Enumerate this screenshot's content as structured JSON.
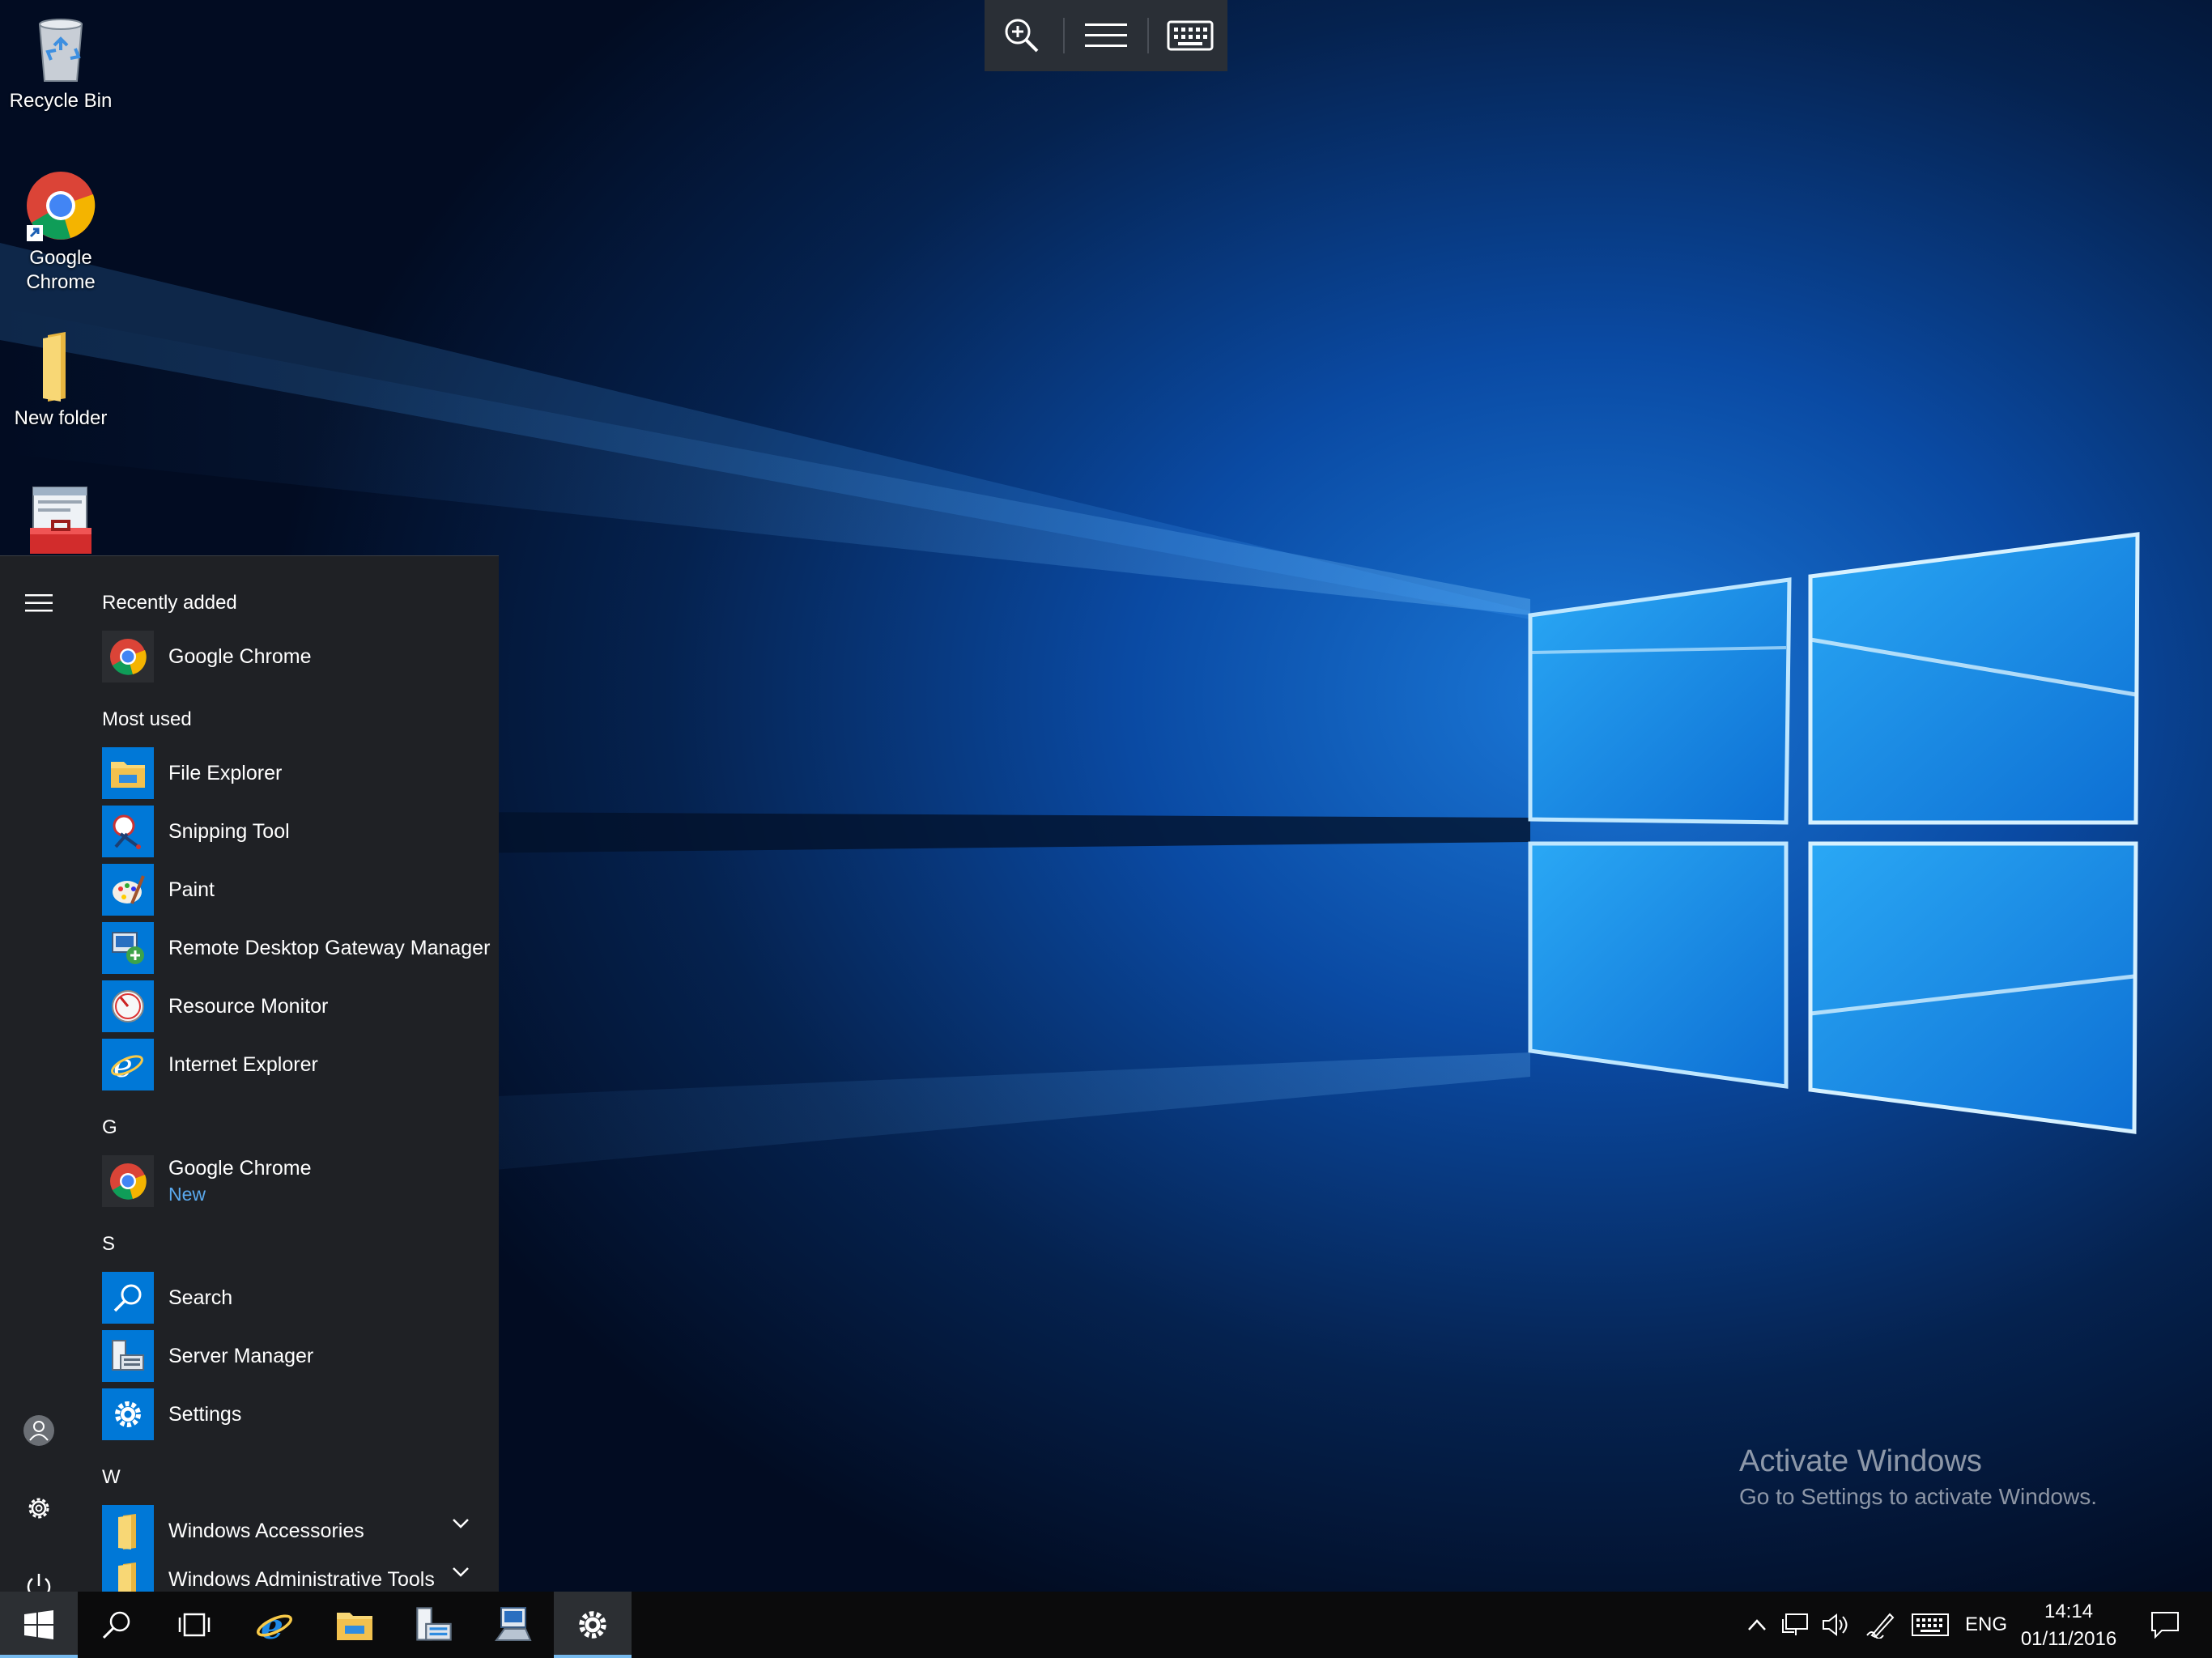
{
  "desktop": {
    "icons": [
      {
        "label": "Recycle Bin"
      },
      {
        "label": "Google Chrome"
      },
      {
        "label": "New folder"
      },
      {
        "label": ""
      }
    ]
  },
  "rdp_toolbar": {
    "buttons": [
      "zoom-in-icon",
      "menu-icon",
      "keyboard-icon"
    ]
  },
  "start_menu": {
    "sections": {
      "recently_added": "Recently added",
      "most_used": "Most used",
      "g": "G",
      "s": "S",
      "w": "W"
    },
    "recently_added": [
      {
        "name": "Google Chrome",
        "icon": "chrome-icon"
      }
    ],
    "most_used": [
      {
        "name": "File Explorer",
        "icon": "file-explorer-icon"
      },
      {
        "name": "Snipping Tool",
        "icon": "snipping-tool-icon"
      },
      {
        "name": "Paint",
        "icon": "paint-icon"
      },
      {
        "name": "Remote Desktop Gateway Manager",
        "icon": "rd-gateway-icon"
      },
      {
        "name": "Resource Monitor",
        "icon": "resource-monitor-icon"
      },
      {
        "name": "Internet Explorer",
        "icon": "internet-explorer-icon"
      }
    ],
    "g_items": [
      {
        "name": "Google Chrome",
        "sub": "New",
        "icon": "chrome-icon"
      }
    ],
    "s_items": [
      {
        "name": "Search",
        "icon": "search-icon"
      },
      {
        "name": "Server Manager",
        "icon": "server-manager-icon"
      },
      {
        "name": "Settings",
        "icon": "settings-icon"
      }
    ],
    "w_items": [
      {
        "name": "Windows Accessories",
        "icon": "folder-icon"
      },
      {
        "name": "Windows Administrative Tools",
        "icon": "folder-icon"
      }
    ]
  },
  "watermark": {
    "title": "Activate Windows",
    "subtitle": "Go to Settings to activate Windows."
  },
  "taskbar": {
    "language": "ENG",
    "time": "14:14",
    "date": "01/11/2016"
  },
  "colors": {
    "accent": "#0078d7",
    "start_bg": "#1f2125",
    "taskbar_bg": "#0b0b0c",
    "new_label": "#5aa9ee"
  }
}
